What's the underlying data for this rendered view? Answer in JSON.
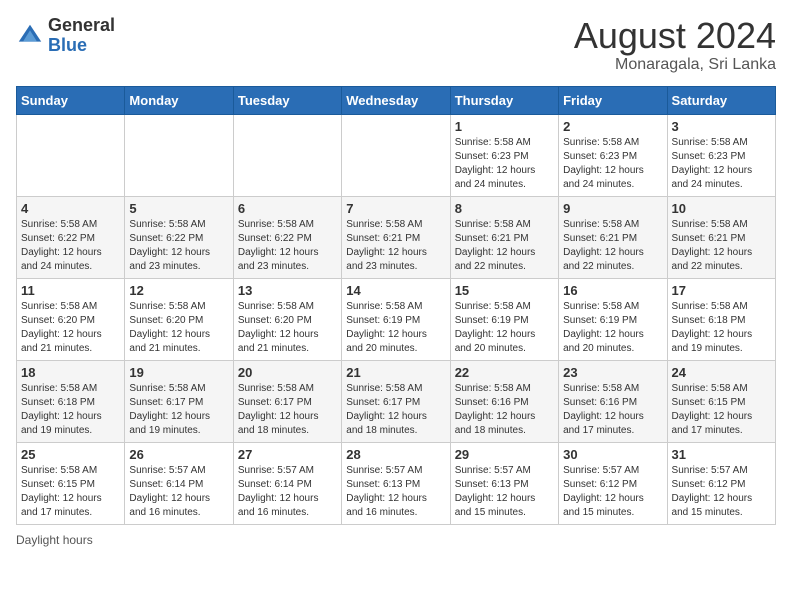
{
  "logo": {
    "general": "General",
    "blue": "Blue"
  },
  "title": "August 2024",
  "subtitle": "Monaragala, Sri Lanka",
  "days_of_week": [
    "Sunday",
    "Monday",
    "Tuesday",
    "Wednesday",
    "Thursday",
    "Friday",
    "Saturday"
  ],
  "weeks": [
    [
      {
        "day": "",
        "info": ""
      },
      {
        "day": "",
        "info": ""
      },
      {
        "day": "",
        "info": ""
      },
      {
        "day": "",
        "info": ""
      },
      {
        "day": "1",
        "info": "Sunrise: 5:58 AM\nSunset: 6:23 PM\nDaylight: 12 hours\nand 24 minutes."
      },
      {
        "day": "2",
        "info": "Sunrise: 5:58 AM\nSunset: 6:23 PM\nDaylight: 12 hours\nand 24 minutes."
      },
      {
        "day": "3",
        "info": "Sunrise: 5:58 AM\nSunset: 6:23 PM\nDaylight: 12 hours\nand 24 minutes."
      }
    ],
    [
      {
        "day": "4",
        "info": "Sunrise: 5:58 AM\nSunset: 6:22 PM\nDaylight: 12 hours\nand 24 minutes."
      },
      {
        "day": "5",
        "info": "Sunrise: 5:58 AM\nSunset: 6:22 PM\nDaylight: 12 hours\nand 23 minutes."
      },
      {
        "day": "6",
        "info": "Sunrise: 5:58 AM\nSunset: 6:22 PM\nDaylight: 12 hours\nand 23 minutes."
      },
      {
        "day": "7",
        "info": "Sunrise: 5:58 AM\nSunset: 6:21 PM\nDaylight: 12 hours\nand 23 minutes."
      },
      {
        "day": "8",
        "info": "Sunrise: 5:58 AM\nSunset: 6:21 PM\nDaylight: 12 hours\nand 22 minutes."
      },
      {
        "day": "9",
        "info": "Sunrise: 5:58 AM\nSunset: 6:21 PM\nDaylight: 12 hours\nand 22 minutes."
      },
      {
        "day": "10",
        "info": "Sunrise: 5:58 AM\nSunset: 6:21 PM\nDaylight: 12 hours\nand 22 minutes."
      }
    ],
    [
      {
        "day": "11",
        "info": "Sunrise: 5:58 AM\nSunset: 6:20 PM\nDaylight: 12 hours\nand 21 minutes."
      },
      {
        "day": "12",
        "info": "Sunrise: 5:58 AM\nSunset: 6:20 PM\nDaylight: 12 hours\nand 21 minutes."
      },
      {
        "day": "13",
        "info": "Sunrise: 5:58 AM\nSunset: 6:20 PM\nDaylight: 12 hours\nand 21 minutes."
      },
      {
        "day": "14",
        "info": "Sunrise: 5:58 AM\nSunset: 6:19 PM\nDaylight: 12 hours\nand 20 minutes."
      },
      {
        "day": "15",
        "info": "Sunrise: 5:58 AM\nSunset: 6:19 PM\nDaylight: 12 hours\nand 20 minutes."
      },
      {
        "day": "16",
        "info": "Sunrise: 5:58 AM\nSunset: 6:19 PM\nDaylight: 12 hours\nand 20 minutes."
      },
      {
        "day": "17",
        "info": "Sunrise: 5:58 AM\nSunset: 6:18 PM\nDaylight: 12 hours\nand 19 minutes."
      }
    ],
    [
      {
        "day": "18",
        "info": "Sunrise: 5:58 AM\nSunset: 6:18 PM\nDaylight: 12 hours\nand 19 minutes."
      },
      {
        "day": "19",
        "info": "Sunrise: 5:58 AM\nSunset: 6:17 PM\nDaylight: 12 hours\nand 19 minutes."
      },
      {
        "day": "20",
        "info": "Sunrise: 5:58 AM\nSunset: 6:17 PM\nDaylight: 12 hours\nand 18 minutes."
      },
      {
        "day": "21",
        "info": "Sunrise: 5:58 AM\nSunset: 6:17 PM\nDaylight: 12 hours\nand 18 minutes."
      },
      {
        "day": "22",
        "info": "Sunrise: 5:58 AM\nSunset: 6:16 PM\nDaylight: 12 hours\nand 18 minutes."
      },
      {
        "day": "23",
        "info": "Sunrise: 5:58 AM\nSunset: 6:16 PM\nDaylight: 12 hours\nand 17 minutes."
      },
      {
        "day": "24",
        "info": "Sunrise: 5:58 AM\nSunset: 6:15 PM\nDaylight: 12 hours\nand 17 minutes."
      }
    ],
    [
      {
        "day": "25",
        "info": "Sunrise: 5:58 AM\nSunset: 6:15 PM\nDaylight: 12 hours\nand 17 minutes."
      },
      {
        "day": "26",
        "info": "Sunrise: 5:57 AM\nSunset: 6:14 PM\nDaylight: 12 hours\nand 16 minutes."
      },
      {
        "day": "27",
        "info": "Sunrise: 5:57 AM\nSunset: 6:14 PM\nDaylight: 12 hours\nand 16 minutes."
      },
      {
        "day": "28",
        "info": "Sunrise: 5:57 AM\nSunset: 6:13 PM\nDaylight: 12 hours\nand 16 minutes."
      },
      {
        "day": "29",
        "info": "Sunrise: 5:57 AM\nSunset: 6:13 PM\nDaylight: 12 hours\nand 15 minutes."
      },
      {
        "day": "30",
        "info": "Sunrise: 5:57 AM\nSunset: 6:12 PM\nDaylight: 12 hours\nand 15 minutes."
      },
      {
        "day": "31",
        "info": "Sunrise: 5:57 AM\nSunset: 6:12 PM\nDaylight: 12 hours\nand 15 minutes."
      }
    ]
  ],
  "footer": "Daylight hours"
}
